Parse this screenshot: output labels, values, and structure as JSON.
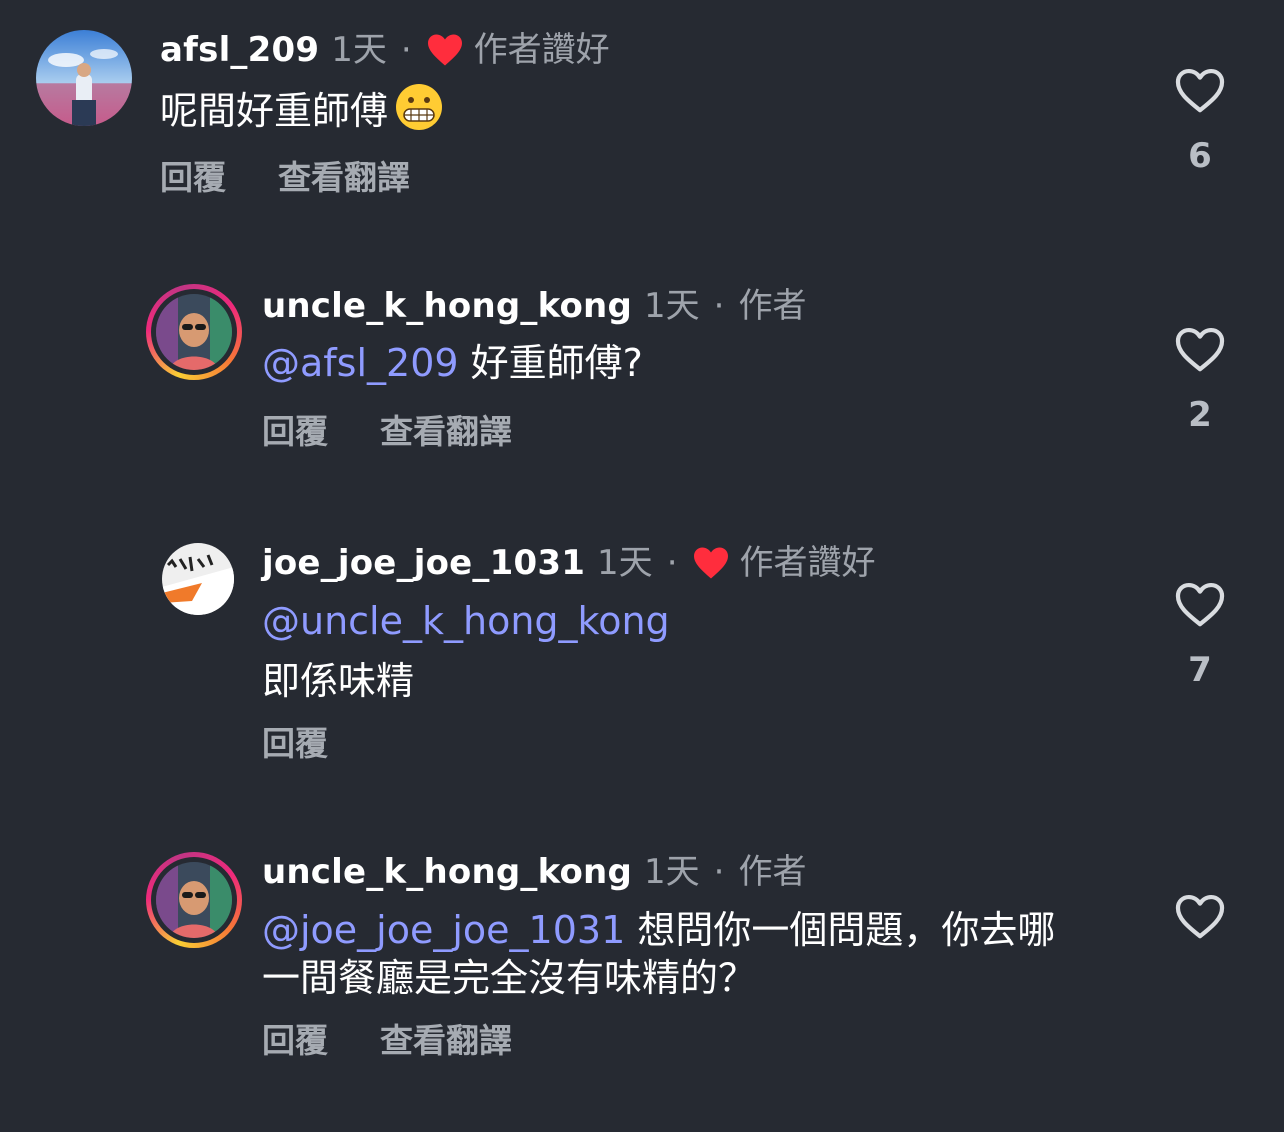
{
  "colors": {
    "background": "#262a32",
    "mention": "#8f9bff",
    "heart_red": "#ff2d3d",
    "muted": "#9ea3ab"
  },
  "comments": [
    {
      "username": "afsl_209",
      "time": "1天",
      "liked_by_author": true,
      "author_liked_label": "作者讚好",
      "text": "呢間好重師傅",
      "emoji": "grimacing-face",
      "actions": [
        "回覆",
        "查看翻譯"
      ],
      "like_count": "6",
      "heart_icon": "heart-outline-icon"
    },
    {
      "username": "uncle_k_hong_kong",
      "time": "1天",
      "author_label": "作者",
      "mention": "@afsl_209",
      "text": " 好重師傅?",
      "actions": [
        "回覆",
        "查看翻譯"
      ],
      "like_count": "2",
      "heart_icon": "heart-outline-icon"
    },
    {
      "username": "joe_joe_joe_1031",
      "time": "1天",
      "liked_by_author": true,
      "author_liked_label": "作者讚好",
      "mention": "@uncle_k_hong_kong",
      "text": "即係味精",
      "actions": [
        "回覆"
      ],
      "like_count": "7",
      "heart_icon": "heart-outline-icon"
    },
    {
      "username": "uncle_k_hong_kong",
      "time": "1天",
      "author_label": "作者",
      "mention": "@joe_joe_joe_1031",
      "text_line1": " 想問你一個問題，你去哪",
      "text_line2": "一間餐廳是完全沒有味精的？",
      "actions": [
        "回覆",
        "查看翻譯"
      ],
      "like_count": "",
      "heart_icon": "heart-outline-icon"
    }
  ],
  "separator": "·"
}
